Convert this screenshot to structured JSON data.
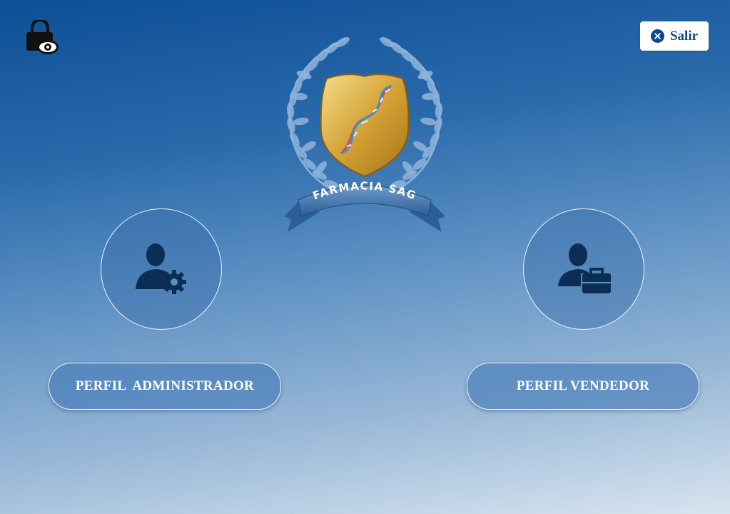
{
  "app": {
    "brand_name": "FARMACIA SAG"
  },
  "header": {
    "lock_icon": "lock-eye-icon",
    "exit_button": {
      "label": "Salir",
      "icon": "close-circle-icon"
    }
  },
  "profiles": [
    {
      "label": "PERFIL  ADMINISTRADOR",
      "icon": "user-gear-icon"
    },
    {
      "label": "PERFIL VENDEDOR",
      "icon": "user-briefcase-icon"
    }
  ],
  "colors": {
    "accent": "#0b4a8d",
    "background_top": "#0d4f96",
    "background_bottom": "#d8e4ef",
    "icon_dark": "#0c2e55",
    "badge_gold": "#d9ab3c"
  }
}
